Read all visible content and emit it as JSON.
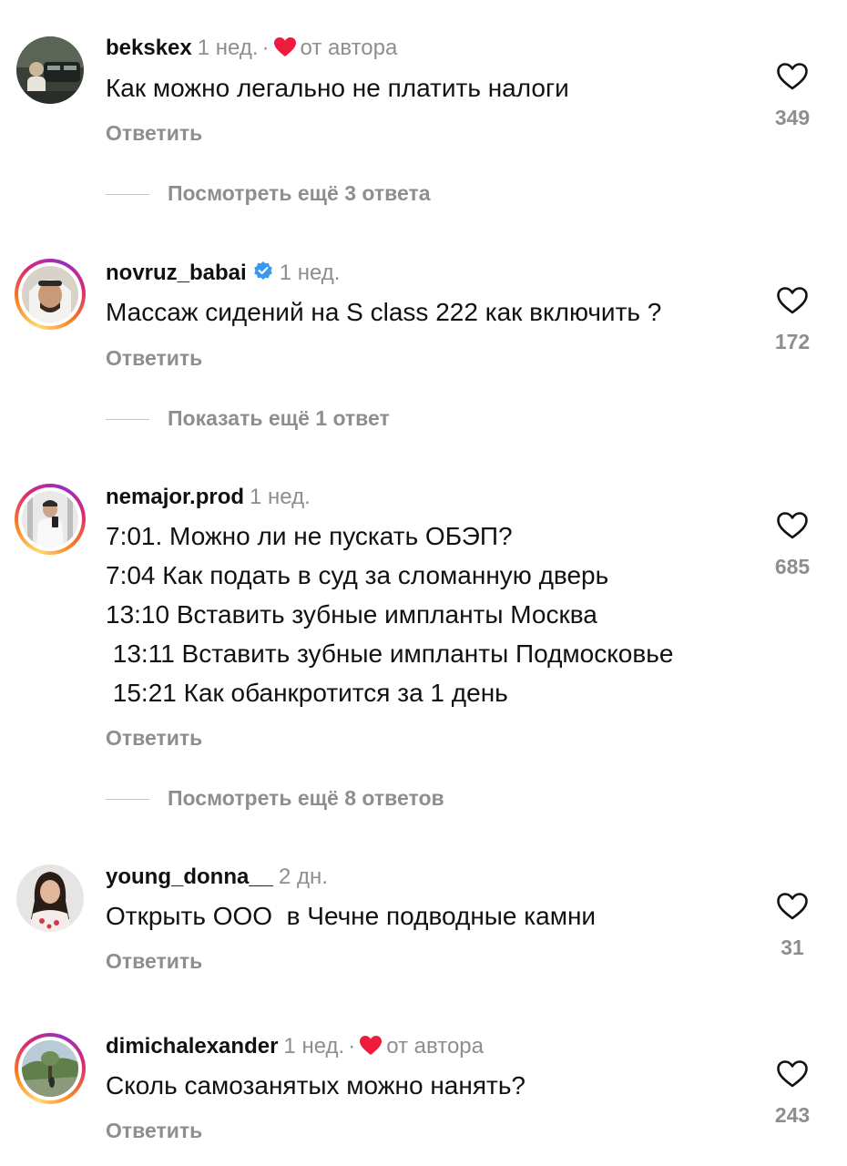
{
  "comments": [
    {
      "username": "bekskex",
      "time": "1 нед.",
      "separator": "·",
      "author_like": "от автора",
      "text": "Как можно легально не платить налоги",
      "reply_label": "Ответить",
      "likes": "349",
      "more_replies": "Посмотреть ещё 3 ответа"
    },
    {
      "username": "novruz_babai",
      "time": "1 нед.",
      "text": "Массаж сидений на S class 222 как включить ?",
      "reply_label": "Ответить",
      "likes": "172",
      "more_replies": "Показать ещё 1 ответ"
    },
    {
      "username": "nemajor.prod",
      "time": "1 нед.",
      "text_lines": [
        "7:01. Можно ли не пускать ОБЭП?",
        "7:04 Как подать в суд за сломанную дверь",
        "13:10 Вставить зубные импланты Москва",
        " 13:11 Вставить зубные импланты Подмосковье",
        " 15:21 Как обанкротится за 1 день"
      ],
      "reply_label": "Ответить",
      "likes": "685",
      "more_replies": "Посмотреть ещё 8 ответов"
    },
    {
      "username": "young_donna__",
      "time": "2 дн.",
      "text": "Открыть ООО  в Чечне подводные камни",
      "reply_label": "Ответить",
      "likes": "31"
    },
    {
      "username": "dimichalexander",
      "time": "1 нед.",
      "separator": "·",
      "author_like": "от автора",
      "text": "Сколь самозанятых можно нанять?",
      "reply_label": "Ответить",
      "likes": "243"
    }
  ],
  "colors": {
    "text": "#111111",
    "secondary": "#8e8e8e",
    "heart_red": "#ed1c3c",
    "verified_blue": "#3897f0",
    "story_ring": [
      "#feda75",
      "#fa7e1e",
      "#d62976",
      "#962fbf"
    ]
  },
  "icons": {
    "like": "heart-outline-icon",
    "author_like": "heart-filled-icon",
    "verified": "verified-badge-icon"
  }
}
